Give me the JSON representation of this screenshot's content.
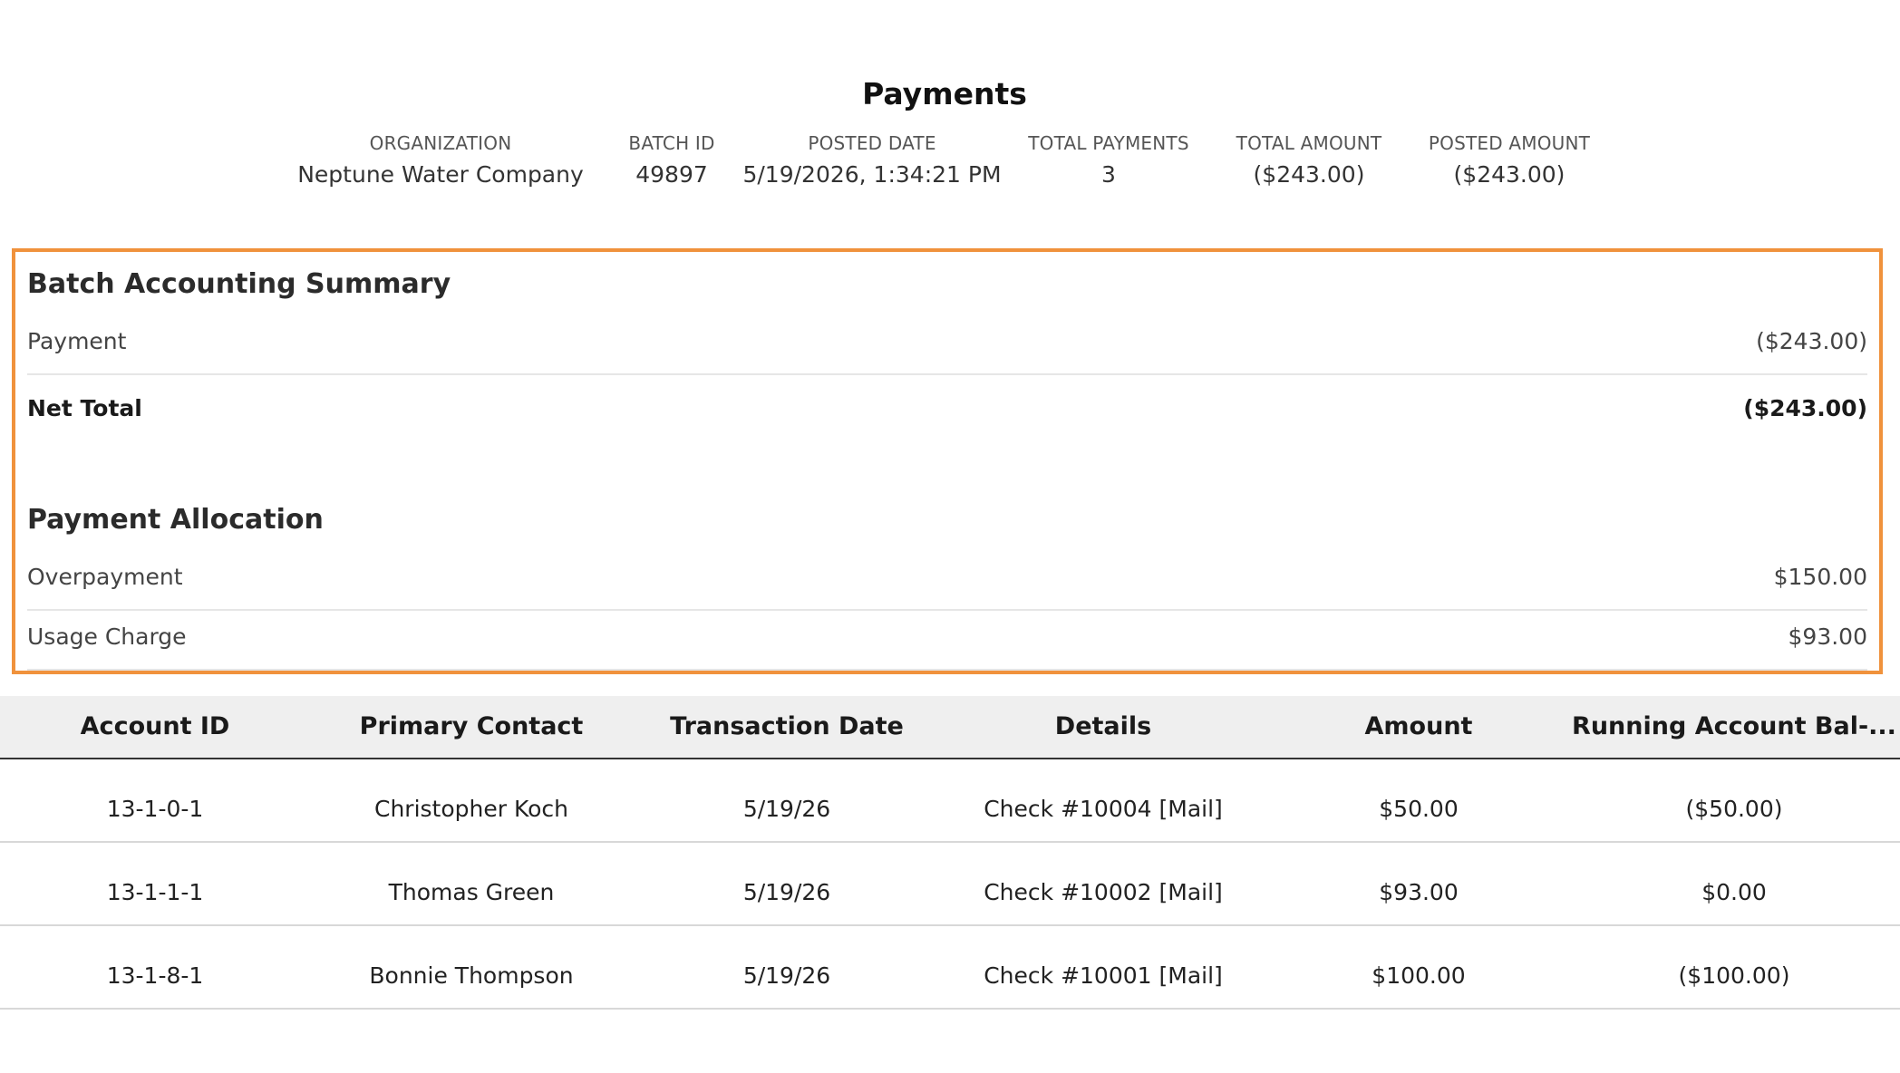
{
  "page": {
    "title": "Payments"
  },
  "meta": [
    {
      "label": "ORGANIZATION",
      "value": "Neptune Water Company"
    },
    {
      "label": "BATCH ID",
      "value": "49897"
    },
    {
      "label": "POSTED DATE",
      "value": "5/19/2026, 1:34:21 PM"
    },
    {
      "label": "TOTAL PAYMENTS",
      "value": "3"
    },
    {
      "label": "TOTAL AMOUNT",
      "value": "($243.00)"
    },
    {
      "label": "POSTED AMOUNT",
      "value": "($243.00)"
    }
  ],
  "batch_summary": {
    "title": "Batch Accounting Summary",
    "rows": [
      {
        "label": "Payment",
        "value": "($243.00)"
      }
    ],
    "net_total_label": "Net Total",
    "net_total_value": "($243.00)"
  },
  "payment_allocation": {
    "title": "Payment Allocation",
    "rows": [
      {
        "label": "Overpayment",
        "value": "$150.00"
      },
      {
        "label": "Usage Charge",
        "value": "$93.00"
      }
    ]
  },
  "table": {
    "columns": [
      "Account ID",
      "Primary Contact",
      "Transaction Date",
      "Details",
      "Amount",
      "Running Account Bal-..."
    ],
    "rows": [
      [
        "13-1-0-1",
        "Christopher Koch",
        "5/19/26",
        "Check #10004 [Mail]",
        "$50.00",
        "($50.00)"
      ],
      [
        "13-1-1-1",
        "Thomas Green",
        "5/19/26",
        "Check #10002 [Mail]",
        "$93.00",
        "$0.00"
      ],
      [
        "13-1-8-1",
        "Bonnie Thompson",
        "5/19/26",
        "Check #10001 [Mail]",
        "$100.00",
        "($100.00)"
      ]
    ]
  },
  "colors": {
    "highlight_border": "#f0923c",
    "header_background": "#efefef"
  }
}
